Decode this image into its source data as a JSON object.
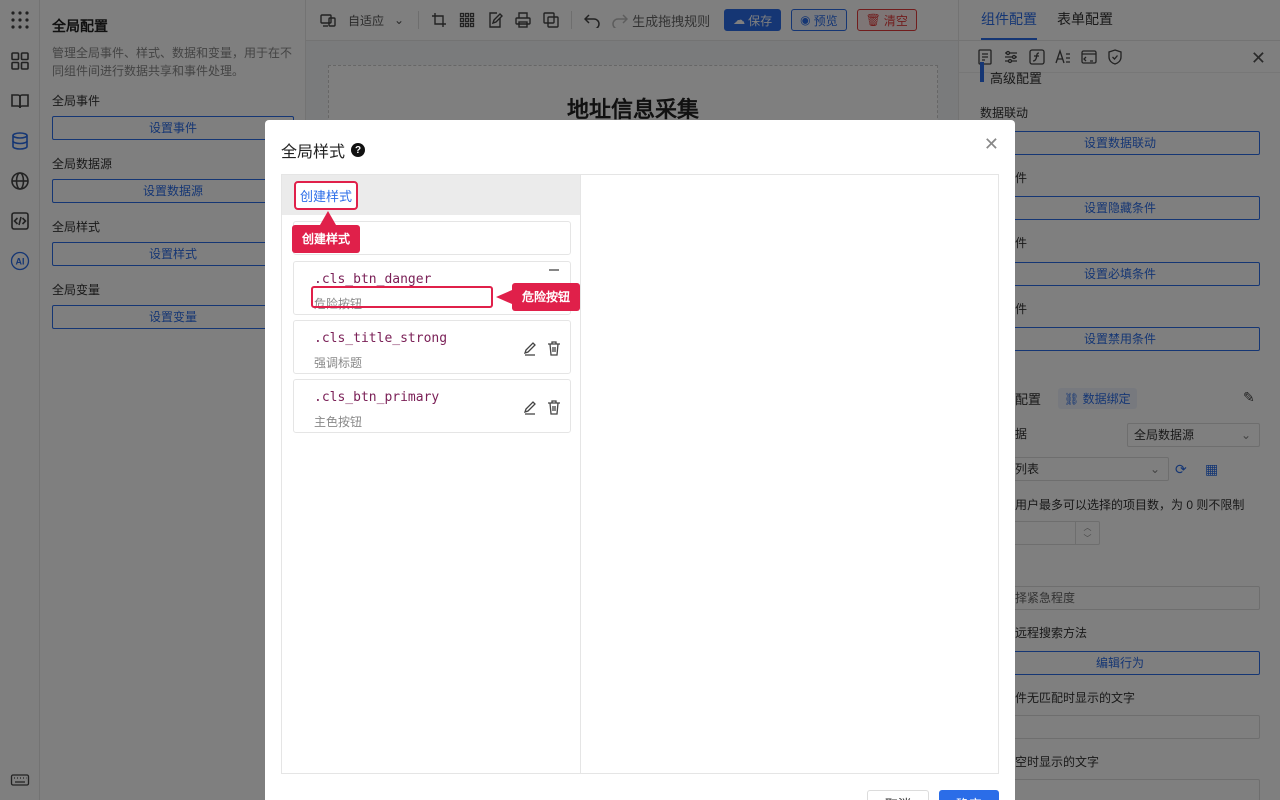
{
  "left_panel": {
    "title": "全局配置",
    "description": "管理全局事件、样式、数据和变量，用于在不同组件间进行数据共享和事件处理。",
    "sections": [
      {
        "label": "全局事件",
        "button": "设置事件"
      },
      {
        "label": "全局数据源",
        "button": "设置数据源"
      },
      {
        "label": "全局样式",
        "button": "设置样式"
      },
      {
        "label": "全局变量",
        "button": "设置变量"
      }
    ]
  },
  "toolbar": {
    "device_select": "自适应",
    "rule_label": "生成拖拽规则",
    "save": "保存",
    "preview": "预览",
    "clear": "清空"
  },
  "canvas": {
    "form_title": "地址信息采集"
  },
  "right_panel": {
    "tabs": [
      "组件配置",
      "表单配置"
    ],
    "advanced_label": "高级配置",
    "data_link_label": "数据联动",
    "buttons": [
      "设置数据联动",
      "设置隐藏条件",
      "设置必填条件",
      "设置禁用条件",
      "编辑行为"
    ],
    "row_labels": [
      "件",
      "件",
      "件"
    ],
    "config_label": "配置",
    "bind_label": "数据绑定",
    "data_label": "据",
    "datasource_select": "全局数据源",
    "list_select": "列表",
    "max_hint": "用户最多可以选择的项目数，为 0 则不限制",
    "urgency_value": "择紧急程度",
    "remote_label": "远程搜索方法",
    "nomatch_label": "件无匹配时显示的文字",
    "empty_label": "空时显示的文字"
  },
  "modal": {
    "title": "全局样式",
    "help_glyph": "?",
    "create_link": "创建样式",
    "styles": [
      {
        "name": ".cls_btn_danger",
        "desc": "危险按钮"
      },
      {
        "name": ".cls_title_strong",
        "desc": "强调标题"
      },
      {
        "name": ".cls_btn_primary",
        "desc": "主色按钮"
      }
    ],
    "cancel": "取消",
    "ok": "确定"
  },
  "callouts": {
    "create": "创建样式",
    "danger": "危险按钮"
  },
  "colors": {
    "primary": "#2b6de8",
    "danger": "#e23b3b",
    "callout": "#e0204a",
    "style_name": "#7a1f56"
  }
}
